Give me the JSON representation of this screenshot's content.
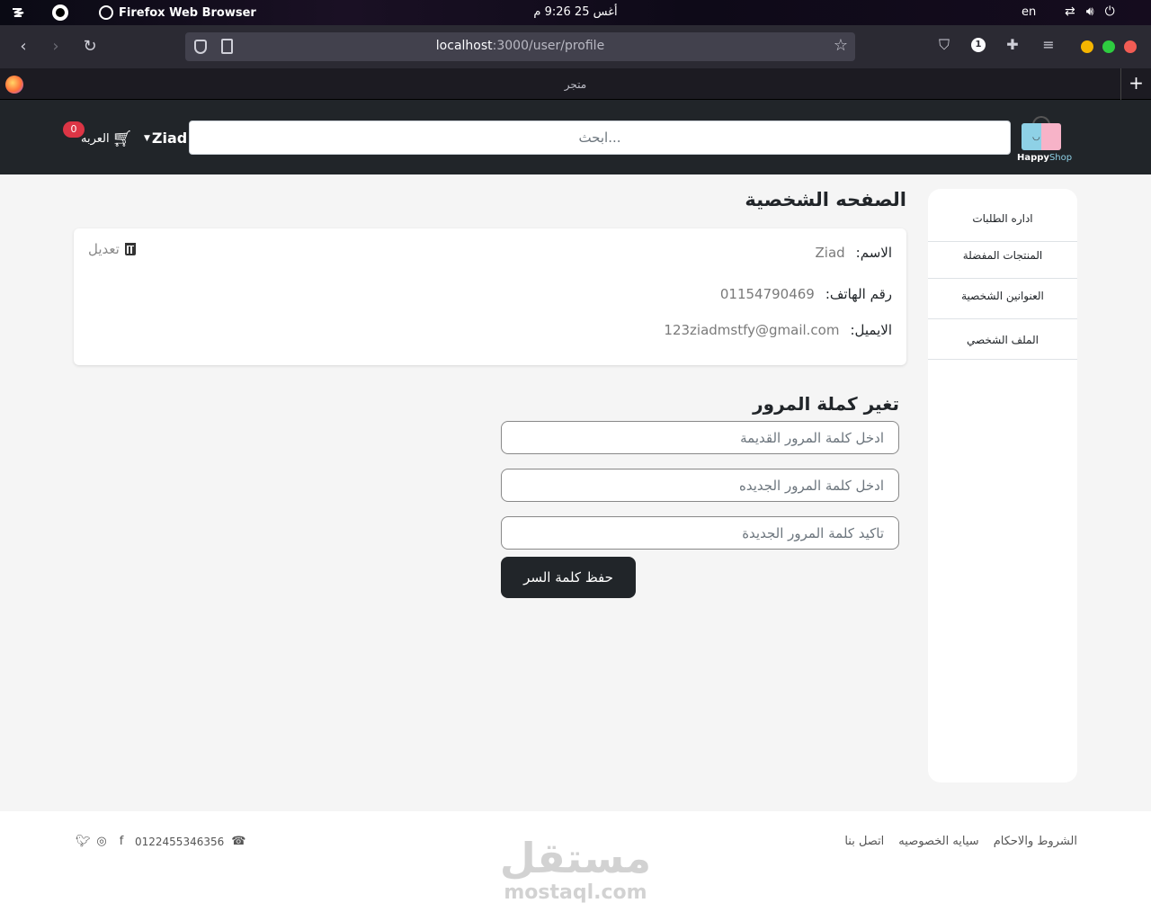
{
  "os": {
    "app_name": "Firefox Web Browser",
    "clock": "أغس 25  9:26 م",
    "lang": "en"
  },
  "browser": {
    "url_host": "localhost",
    "url_path": ":3000/user/profile",
    "tab_title": "متجر",
    "extensions_badge": "1"
  },
  "header": {
    "logo_text_a": "Happy",
    "logo_text_b": "Shop",
    "search_placeholder": "ابحث...",
    "user_name": "Ziad",
    "cart_label": "العربه",
    "cart_count": "0"
  },
  "sidebar": {
    "items": [
      {
        "label": "اداره الطلبات"
      },
      {
        "label": "المنتجات المفضلة"
      },
      {
        "label": "العنوانين الشخصية"
      },
      {
        "label": "الملف الشخصي"
      }
    ]
  },
  "profile": {
    "title": "الصفحه الشخصية",
    "edit_label": "تعديل",
    "name_label": "الاسم:",
    "name_value": "Ziad",
    "phone_label": "رقم الهاتف:",
    "phone_value": "01154790469",
    "email_label": "الايميل:",
    "email_value": "123ziadmstfy@gmail.com"
  },
  "password": {
    "title": "تغير كملة المرور",
    "old_placeholder": "ادخل كلمة المرور القديمة",
    "new_placeholder": "ادخل كلمة المرور الجديده",
    "confirm_placeholder": "تاكيد كلمة المرور الجديدة",
    "save_label": "حفظ كلمة السر"
  },
  "footer": {
    "links": [
      {
        "label": "الشروط والاحكام"
      },
      {
        "label": "سيايه الخصوصيه"
      },
      {
        "label": "اتصل بنا"
      }
    ],
    "phone": "0122455346356",
    "watermark_ar": "مستقل",
    "watermark_en": "mostaql.com"
  }
}
